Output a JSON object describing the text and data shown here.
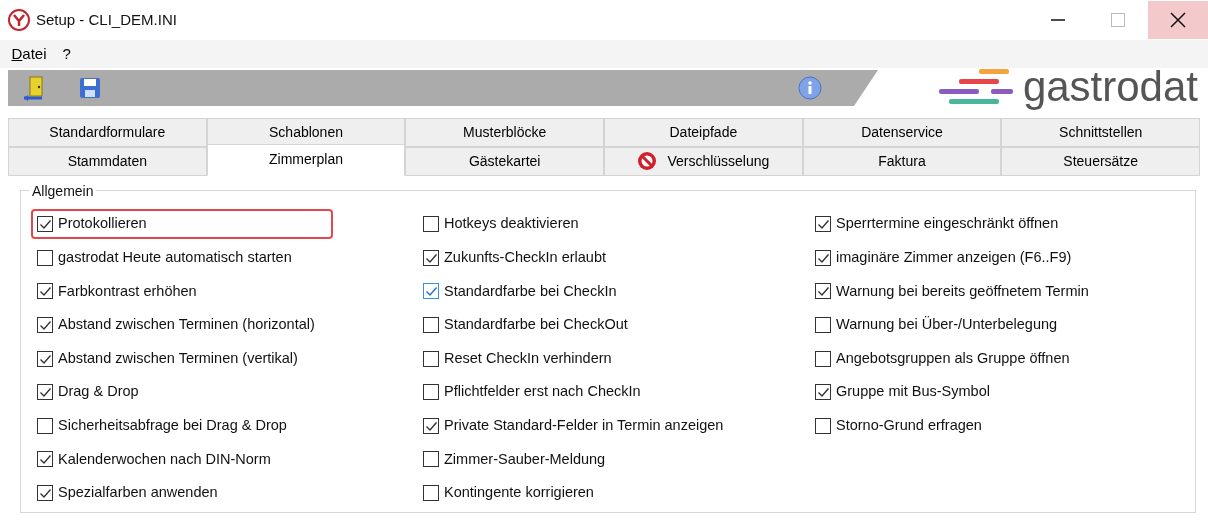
{
  "window": {
    "title": "Setup - CLI_DEM.INI"
  },
  "menu": [
    {
      "label": "Datei"
    },
    {
      "label": "?"
    }
  ],
  "logo": {
    "text": "gastrodat"
  },
  "tab_rows": [
    [
      {
        "label": "Standardformulare",
        "selected": false
      },
      {
        "label": "Schablonen",
        "selected": false
      },
      {
        "label": "Musterblöcke",
        "selected": false
      },
      {
        "label": "Dateipfade",
        "selected": false
      },
      {
        "label": "Datenservice",
        "selected": false
      },
      {
        "label": "Schnittstellen",
        "selected": false
      }
    ],
    [
      {
        "label": "Stammdaten",
        "selected": false
      },
      {
        "label": "Zimmerplan",
        "selected": true
      },
      {
        "label": "Gästekartei",
        "selected": false
      },
      {
        "label": "Verschlüsselung",
        "selected": false,
        "icon": true
      },
      {
        "label": "Faktura",
        "selected": false
      },
      {
        "label": "Steuersätze",
        "selected": false
      }
    ]
  ],
  "group": {
    "title": "Allgemein",
    "columns": [
      [
        {
          "label": "Protokollieren",
          "checked": true,
          "highlighted": true
        },
        {
          "label": "gastrodat Heute automatisch starten",
          "checked": false
        },
        {
          "label": "Farbkontrast erhöhen",
          "checked": true
        },
        {
          "label": "Abstand zwischen Terminen (horizontal)",
          "checked": true
        },
        {
          "label": "Abstand zwischen Terminen (vertikal)",
          "checked": true
        },
        {
          "label": "Drag & Drop",
          "checked": true
        },
        {
          "label": "Sicherheitsabfrage bei Drag & Drop",
          "checked": false
        },
        {
          "label": "Kalenderwochen nach DIN-Norm",
          "checked": true
        },
        {
          "label": "Spezialfarben anwenden",
          "checked": true
        }
      ],
      [
        {
          "label": "Hotkeys deaktivieren",
          "checked": false
        },
        {
          "label": "Zukunfts-CheckIn erlaubt",
          "checked": true
        },
        {
          "label": "Standardfarbe bei CheckIn",
          "checked": true,
          "focused": true
        },
        {
          "label": "Standardfarbe bei CheckOut",
          "checked": false
        },
        {
          "label": "Reset CheckIn verhindern",
          "checked": false
        },
        {
          "label": "Pflichtfelder erst nach CheckIn",
          "checked": false
        },
        {
          "label": "Private Standard-Felder in Termin anzeigen",
          "checked": true
        },
        {
          "label": "Zimmer-Sauber-Meldung",
          "checked": false
        },
        {
          "label": "Kontingente korrigieren",
          "checked": false
        }
      ],
      [
        {
          "label": "Sperrtermine eingeschränkt öffnen",
          "checked": true
        },
        {
          "label": "imaginäre Zimmer anzeigen (F6..F9)",
          "checked": true
        },
        {
          "label": "Warnung bei bereits geöffnetem Termin",
          "checked": true
        },
        {
          "label": "Warnung bei Über-/Unterbelegung",
          "checked": false
        },
        {
          "label": "Angebotsgruppen als Gruppe öffnen",
          "checked": false
        },
        {
          "label": "Gruppe mit Bus-Symbol",
          "checked": true
        },
        {
          "label": "Storno-Grund erfragen",
          "checked": false
        }
      ]
    ]
  }
}
